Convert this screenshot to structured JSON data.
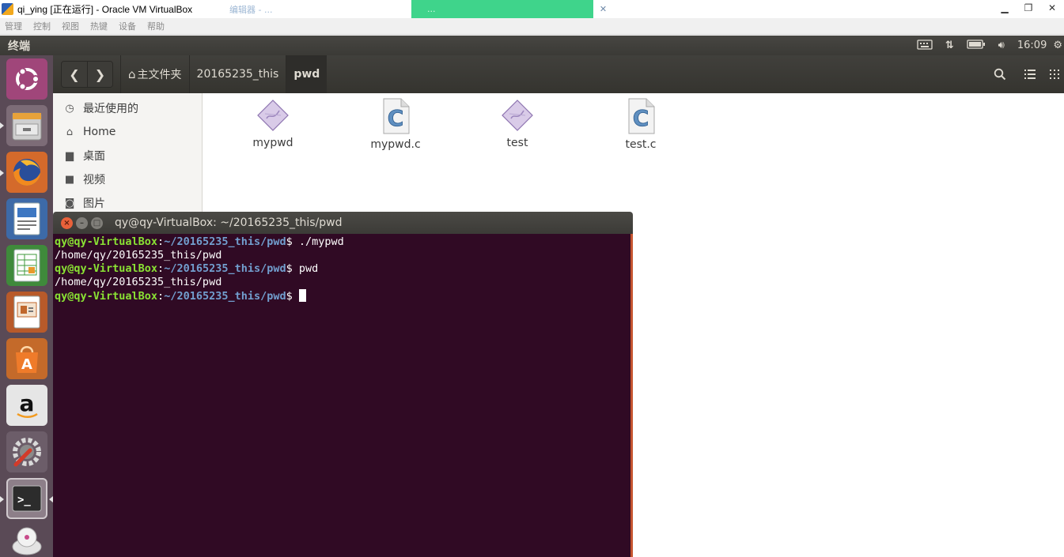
{
  "host": {
    "title": "qi_ying [正在运行] - Oracle VM VirtualBox",
    "menu": [
      "管理",
      "控制",
      "视图",
      "热键",
      "设备",
      "帮助"
    ],
    "tab1_label": "编辑器 - ...",
    "tab2_label": "..."
  },
  "panel": {
    "app_title": "终端",
    "clock": "16:09"
  },
  "files": {
    "crumbs": [
      "主文件夹",
      "20165235_this",
      "pwd"
    ],
    "sidebar": [
      {
        "label": "最近使用的",
        "icon": "clock-icon"
      },
      {
        "label": "Home",
        "icon": "home-icon"
      },
      {
        "label": "桌面",
        "icon": "folder-icon"
      },
      {
        "label": "视频",
        "icon": "video-icon"
      },
      {
        "label": "图片",
        "icon": "camera-icon"
      }
    ],
    "items": [
      {
        "name": "mypwd",
        "type": "executable"
      },
      {
        "name": "mypwd.c",
        "type": "c-source"
      },
      {
        "name": "test",
        "type": "executable"
      },
      {
        "name": "test.c",
        "type": "c-source"
      }
    ]
  },
  "terminal": {
    "title": "qy@qy-VirtualBox: ~/20165235_this/pwd",
    "user_host": "qy@qy-VirtualBox",
    "path": "~/20165235_this/pwd",
    "lines": [
      {
        "cmd": " ./mypwd"
      },
      {
        "out": "/home/qy/20165235_this/pwd"
      },
      {
        "cmd": " pwd"
      },
      {
        "out": "/home/qy/20165235_this/pwd"
      },
      {
        "cmd": " "
      }
    ]
  },
  "colors": {
    "terminal_bg": "#300a24",
    "prompt_user": "#8ae234",
    "prompt_path": "#729fcf",
    "launcher_bg": "#5a4a56",
    "panel_bg": "#3c3b37"
  }
}
